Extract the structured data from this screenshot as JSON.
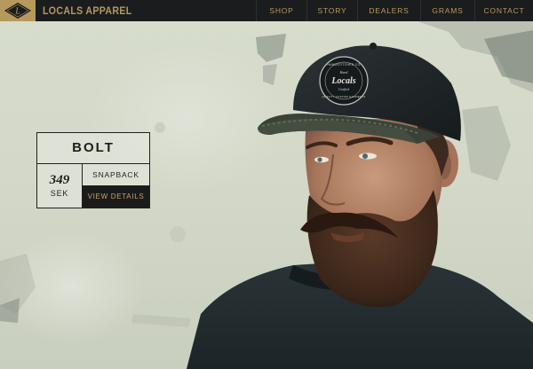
{
  "brand": {
    "logo_text": "L",
    "name": "LOCALS APPAREL"
  },
  "nav": {
    "items": [
      {
        "label": "SHOP"
      },
      {
        "label": "STORY"
      },
      {
        "label": "DEALERS"
      },
      {
        "label": "GRAMS"
      },
      {
        "label": "CONTACT"
      }
    ]
  },
  "product": {
    "name": "BOLT",
    "price": "349",
    "currency": "SEK",
    "type": "SNAPBACK",
    "cta": "VIEW DETAILS"
  },
  "cap_patch": {
    "top": "HANDSTITCHED CO",
    "small": "Hand",
    "script": "Locals",
    "small2": "Crafted",
    "bottom": "QUALITY CUSTOM GARMENTS"
  },
  "colors": {
    "accent": "#b69a5c",
    "nav_background": "#1b1c1e",
    "button_background": "#1b1b1b",
    "wall": "#d7dccd"
  }
}
